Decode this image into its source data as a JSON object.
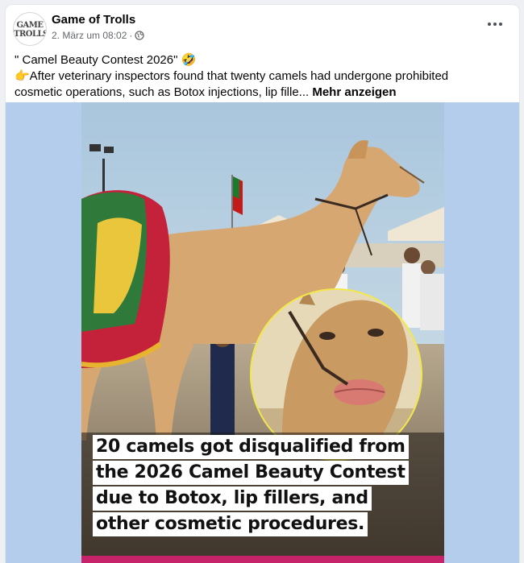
{
  "post": {
    "page_name": "Game of Trolls",
    "avatar_text_line1": "GAME",
    "avatar_text_line2": "TROLLS",
    "timestamp": "2. März um 08:02",
    "separator": "·",
    "audience_icon": "globe-icon",
    "menu_icon": "more-horizontal-icon",
    "text_line1": "\" Camel Beauty Contest 2026\" 🤣",
    "text_line2": "👉After veterinary inspectors found that twenty camels had undergone prohibited cosmetic operations, such as Botox injections, lip fille...",
    "see_more": "Mehr anzeigen"
  },
  "image": {
    "caption_lines": [
      "20 camels got disqualified from",
      "the 2026 Camel Beauty Contest",
      "due to Botox, lip fillers, and",
      "other cosmetic procedures."
    ]
  },
  "colors": {
    "media_background": "#b4cdec",
    "text_primary": "#050505",
    "text_secondary": "#65676b",
    "inset_border": "#f2e84a"
  }
}
